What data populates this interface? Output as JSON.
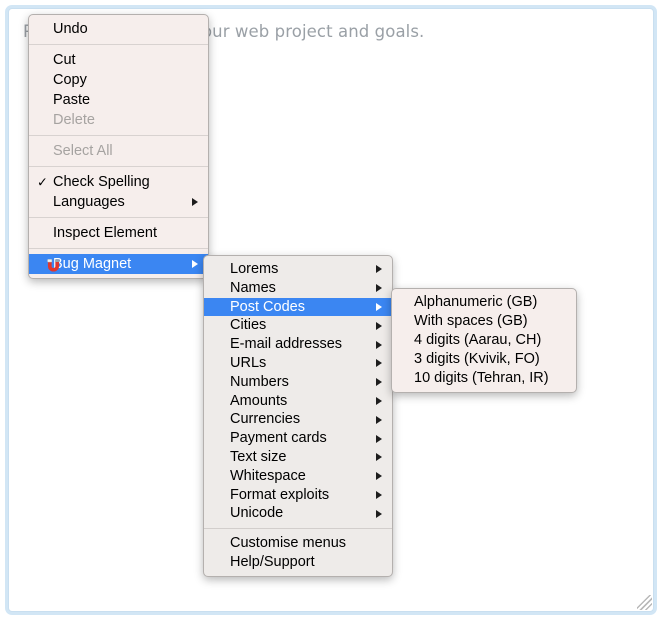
{
  "page": {
    "textarea": {
      "placeholder": "Please tell us about your web project and goals.",
      "value": ""
    }
  },
  "context_menu": {
    "items": [
      {
        "label": "Undo",
        "state": "enabled",
        "submenu": false,
        "checked": false
      },
      {
        "type": "separator"
      },
      {
        "label": "Cut",
        "state": "enabled",
        "submenu": false,
        "checked": false
      },
      {
        "label": "Copy",
        "state": "enabled",
        "submenu": false,
        "checked": false
      },
      {
        "label": "Paste",
        "state": "enabled",
        "submenu": false,
        "checked": false
      },
      {
        "label": "Delete",
        "state": "disabled",
        "submenu": false,
        "checked": false
      },
      {
        "type": "separator"
      },
      {
        "label": "Select All",
        "state": "disabled",
        "submenu": false,
        "checked": false
      },
      {
        "type": "separator"
      },
      {
        "label": "Check Spelling",
        "state": "enabled",
        "submenu": false,
        "checked": true
      },
      {
        "label": "Languages",
        "state": "enabled",
        "submenu": true,
        "checked": false
      },
      {
        "type": "separator"
      },
      {
        "label": "Inspect Element",
        "state": "enabled",
        "submenu": false,
        "checked": false
      },
      {
        "type": "separator"
      },
      {
        "label": "Bug Magnet",
        "state": "selected",
        "submenu": true,
        "checked": false,
        "icon": "magnet-icon"
      }
    ]
  },
  "bug_magnet_menu": {
    "items": [
      {
        "label": "Lorems",
        "state": "enabled",
        "submenu": true
      },
      {
        "label": "Names",
        "state": "enabled",
        "submenu": true
      },
      {
        "label": "Post Codes",
        "state": "selected",
        "submenu": true
      },
      {
        "label": "Cities",
        "state": "enabled",
        "submenu": true
      },
      {
        "label": "E-mail addresses",
        "state": "enabled",
        "submenu": true
      },
      {
        "label": "URLs",
        "state": "enabled",
        "submenu": true
      },
      {
        "label": "Numbers",
        "state": "enabled",
        "submenu": true
      },
      {
        "label": "Amounts",
        "state": "enabled",
        "submenu": true
      },
      {
        "label": "Currencies",
        "state": "enabled",
        "submenu": true
      },
      {
        "label": "Payment cards",
        "state": "enabled",
        "submenu": true
      },
      {
        "label": "Text size",
        "state": "enabled",
        "submenu": true
      },
      {
        "label": "Whitespace",
        "state": "enabled",
        "submenu": true
      },
      {
        "label": "Format exploits",
        "state": "enabled",
        "submenu": true
      },
      {
        "label": "Unicode",
        "state": "enabled",
        "submenu": true
      },
      {
        "type": "separator"
      },
      {
        "label": "Customise menus",
        "state": "enabled",
        "submenu": false
      },
      {
        "label": "Help/Support",
        "state": "enabled",
        "submenu": false
      }
    ]
  },
  "post_codes_menu": {
    "items": [
      {
        "label": "Alphanumeric (GB)",
        "state": "enabled",
        "submenu": false
      },
      {
        "label": "With spaces (GB)",
        "state": "enabled",
        "submenu": false
      },
      {
        "label": "4 digits (Aarau, CH)",
        "state": "enabled",
        "submenu": false
      },
      {
        "label": "3 digits (Kvivik, FO)",
        "state": "enabled",
        "submenu": false
      },
      {
        "label": "10 digits (Tehran, IR)",
        "state": "enabled",
        "submenu": false
      }
    ]
  },
  "colors": {
    "menu_background": "#f6eeec",
    "submenu_background": "#eeebe9",
    "highlight": "#3b86f2",
    "highlight_text": "#ffffff",
    "disabled_text": "#a6a3a1",
    "text": "#000000",
    "placeholder_text": "#9aa0a6",
    "textarea_focus_ring": "#9bc7e8"
  }
}
